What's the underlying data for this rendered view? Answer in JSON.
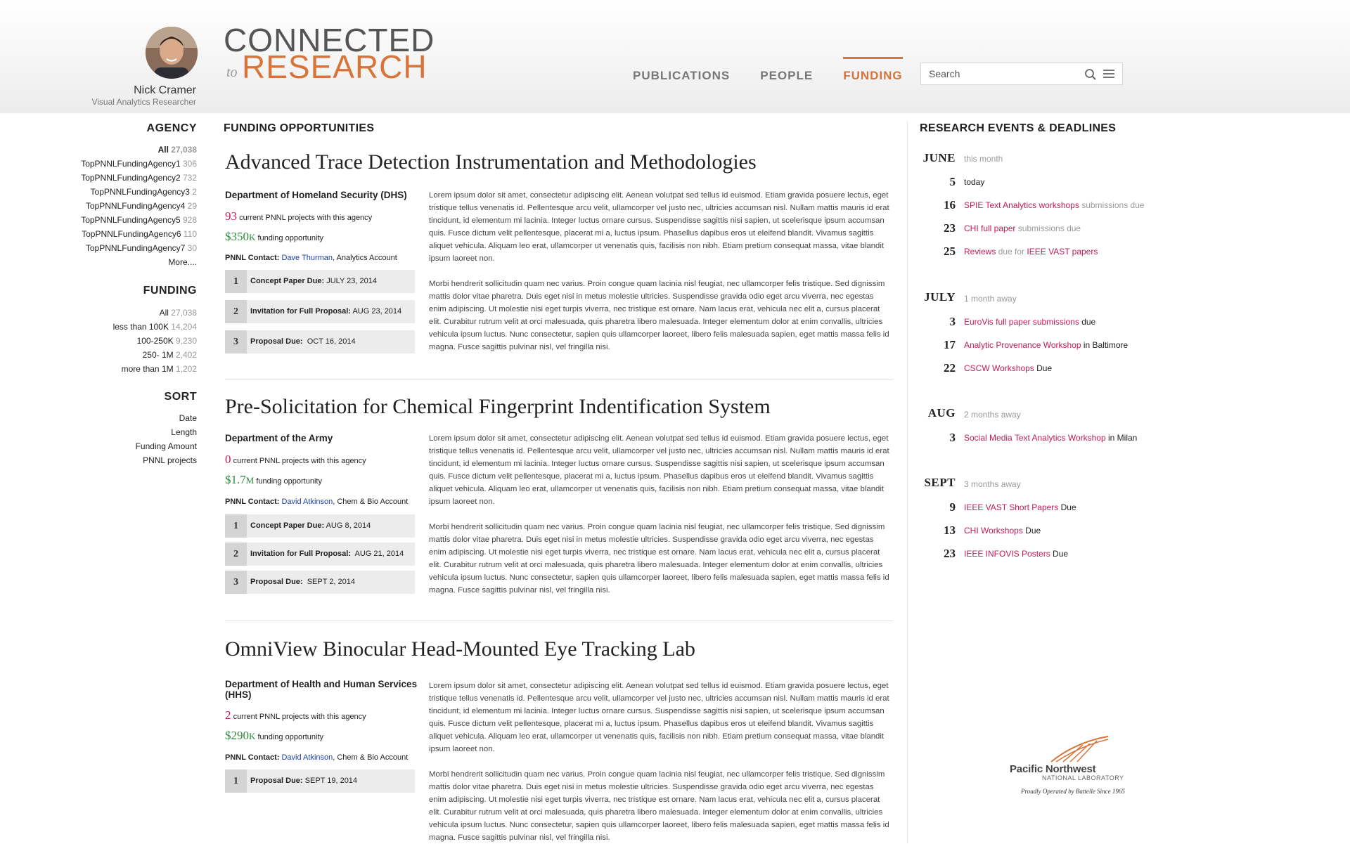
{
  "user": {
    "name": "Nick Cramer",
    "title": "Visual Analytics Researcher"
  },
  "logo": {
    "line1": "CONNECTED",
    "to": "to",
    "line2": "RESEARCH"
  },
  "nav": [
    {
      "label": "PUBLICATIONS",
      "active": false
    },
    {
      "label": "PEOPLE",
      "active": false
    },
    {
      "label": "FUNDING",
      "active": true
    }
  ],
  "search": {
    "placeholder": "Search"
  },
  "colors": {
    "accent": "#d8743a",
    "highlight": "#c21a55",
    "money": "#2e8b3e",
    "link": "#1c3fa8"
  },
  "sidebar": {
    "agency": {
      "heading": "AGENCY",
      "items": [
        {
          "label": "All",
          "count": "27,038"
        },
        {
          "label": "TopPNNLFundingAgency1",
          "count": "306"
        },
        {
          "label": "TopPNNLFundingAgency2",
          "count": "732"
        },
        {
          "label": "TopPNNLFundingAgency3",
          "count": "2"
        },
        {
          "label": "TopPNNLFundingAgency4",
          "count": "29"
        },
        {
          "label": "TopPNNLFundingAgency5",
          "count": "928"
        },
        {
          "label": "TopPNNLFundingAgency6",
          "count": "110"
        },
        {
          "label": "TopPNNLFundingAgency7",
          "count": "30"
        }
      ],
      "more": "More...."
    },
    "funding": {
      "heading": "FUNDING",
      "items": [
        {
          "label": "All",
          "count": "27,038"
        },
        {
          "label": "less than 100K",
          "count": "14,204"
        },
        {
          "label": "100-250K",
          "count": "9,230"
        },
        {
          "label": "250- 1M",
          "count": "2,402"
        },
        {
          "label": "more than 1M",
          "count": "1,202"
        }
      ]
    },
    "sort": {
      "heading": "SORT",
      "items": [
        "Date",
        "Length",
        "Funding Amount",
        "PNNL projects"
      ]
    }
  },
  "main": {
    "heading": "FUNDING OPPORTUNITIES",
    "projects_label": "current PNNL projects with this agency",
    "funding_label": "funding opportunity",
    "contact_label": "PNNL Contact:",
    "opportunities": [
      {
        "title": "Advanced Trace Detection Instrumentation and Methodologies",
        "agency": "Department of Homeland Security (DHS)",
        "projects": "93",
        "amount": "$350",
        "amount_unit": "K",
        "contact_name": "Dave Thurman",
        "contact_account": ", Analytics Account",
        "steps": [
          {
            "n": "1",
            "label": "Concept Paper Due:",
            "date": "JULY 23, 2014"
          },
          {
            "n": "2",
            "label": "Invitation for Full Proposal:",
            "date": "AUG 23, 2014"
          },
          {
            "n": "3",
            "label": "Proposal Due:",
            "date": "OCT 16, 2014"
          }
        ],
        "para1": "Lorem ipsum dolor sit amet, consectetur adipiscing elit. Aenean volutpat sed tellus id euismod. Etiam gravida posuere lectus, eget tristique tellus venenatis id. Pellentesque arcu velit, ullamcorper vel justo nec, ultricies accumsan nisl. Nullam mattis mauris id erat tincidunt, id elementum mi lacinia. Integer luctus ornare cursus. Suspendisse sagittis nisi sapien, ut scelerisque ipsum accumsan quis. Fusce dictum velit pellentesque, placerat mi a, luctus ipsum. Phasellus dapibus eros ut eleifend blandit. Vivamus sagittis aliquet vehicula. Aliquam leo erat, ullamcorper ut venenatis quis, facilisis non nibh. Etiam pretium consequat massa, vitae blandit ipsum laoreet non.",
        "para2": "Morbi hendrerit sollicitudin quam nec varius. Proin congue quam lacinia nisl feugiat, nec ullamcorper felis tristique. Sed dignissim mattis dolor vitae pharetra. Duis eget nisi in metus molestie ultricies. Suspendisse gravida odio eget arcu viverra, nec egestas enim adipiscing. Ut molestie nisi eget turpis viverra, nec tristique est ornare. Nam lacus erat, vehicula nec elit a, cursus placerat elit. Curabitur rutrum velit at orci malesuada, quis pharetra libero malesuada. Integer elementum dolor at enim convallis, ultricies vehicula ipsum luctus. Nunc consectetur, sapien quis ullamcorper laoreet, libero felis malesuada sapien, eget mattis massa felis id magna. Fusce sagittis pulvinar nisl, vel fringilla nisi."
      },
      {
        "title": "Pre-Solicitation for Chemical Fingerprint Indentification System",
        "agency": "Department of the Army",
        "projects": "0",
        "amount": "$1.7",
        "amount_unit": "M",
        "contact_name": "David Atkinson",
        "contact_account": ", Chem & Bio Account",
        "steps": [
          {
            "n": "1",
            "label": "Concept Paper Due:",
            "date": "AUG 8, 2014"
          },
          {
            "n": "2",
            "label": "Invitation for Full Proposal:",
            "date": "AUG 21, 2014"
          },
          {
            "n": "3",
            "label": "Proposal Due:",
            "date": "SEPT 2, 2014"
          }
        ],
        "para1": "Lorem ipsum dolor sit amet, consectetur adipiscing elit. Aenean volutpat sed tellus id euismod. Etiam gravida posuere lectus, eget tristique tellus venenatis id. Pellentesque arcu velit, ullamcorper vel justo nec, ultricies accumsan nisl. Nullam mattis mauris id erat tincidunt, id elementum mi lacinia. Integer luctus ornare cursus. Suspendisse sagittis nisi sapien, ut scelerisque ipsum accumsan quis. Fusce dictum velit pellentesque, placerat mi a, luctus ipsum. Phasellus dapibus eros ut eleifend blandit. Vivamus sagittis aliquet vehicula. Aliquam leo erat, ullamcorper ut venenatis quis, facilisis non nibh. Etiam pretium consequat massa, vitae blandit ipsum laoreet non.",
        "para2": "Morbi hendrerit sollicitudin quam nec varius. Proin congue quam lacinia nisl feugiat, nec ullamcorper felis tristique. Sed dignissim mattis dolor vitae pharetra. Duis eget nisi in metus molestie ultricies. Suspendisse gravida odio eget arcu viverra, nec egestas enim adipiscing. Ut molestie nisi eget turpis viverra, nec tristique est ornare. Nam lacus erat, vehicula nec elit a, cursus placerat elit. Curabitur rutrum velit at orci malesuada, quis pharetra libero malesuada. Integer elementum dolor at enim convallis, ultricies vehicula ipsum luctus. Nunc consectetur, sapien quis ullamcorper laoreet, libero felis malesuada sapien, eget mattis massa felis id magna. Fusce sagittis pulvinar nisl, vel fringilla nisi."
      },
      {
        "title": "OmniView Binocular Head-Mounted Eye Tracking Lab",
        "agency": "Department of Health and Human Services (HHS)",
        "projects": "2",
        "amount": "$290",
        "amount_unit": "K",
        "contact_name": "David Atkinson",
        "contact_account": ", Chem & Bio Account",
        "steps": [
          {
            "n": "1",
            "label": "Proposal Due:",
            "date": "SEPT 19, 2014"
          }
        ],
        "para1": "Lorem ipsum dolor sit amet, consectetur adipiscing elit. Aenean volutpat sed tellus id euismod. Etiam gravida posuere lectus, eget tristique tellus venenatis id. Pellentesque arcu velit, ullamcorper vel justo nec, ultricies accumsan nisl. Nullam mattis mauris id erat tincidunt, id elementum mi lacinia. Integer luctus ornare cursus. Suspendisse sagittis nisi sapien, ut scelerisque ipsum accumsan quis. Fusce dictum velit pellentesque, placerat mi a, luctus ipsum. Phasellus dapibus eros ut eleifend blandit. Vivamus sagittis aliquet vehicula. Aliquam leo erat, ullamcorper ut venenatis quis, facilisis non nibh. Etiam pretium consequat massa, vitae blandit ipsum laoreet non.",
        "para2": "Morbi hendrerit sollicitudin quam nec varius. Proin congue quam lacinia nisl feugiat, nec ullamcorper felis tristique. Sed dignissim mattis dolor vitae pharetra. Duis eget nisi in metus molestie ultricies. Suspendisse gravida odio eget arcu viverra, nec egestas enim adipiscing. Ut molestie nisi eget turpis viverra, nec tristique est ornare. Nam lacus erat, vehicula nec elit a, cursus placerat elit. Curabitur rutrum velit at orci malesuada, quis pharetra libero malesuada. Integer elementum dolor at enim convallis, ultricies vehicula ipsum luctus. Nunc consectetur, sapien quis ullamcorper laoreet, libero felis malesuada sapien, eget mattis massa felis id magna. Fusce sagittis pulvinar nisl, vel fringilla nisi."
      }
    ]
  },
  "events": {
    "heading": "RESEARCH EVENTS & DEADLINES",
    "months": [
      {
        "name": "JUNE",
        "relative": "this month",
        "items": [
          {
            "day": "5",
            "parts": [
              {
                "t": "today",
                "s": ""
              }
            ]
          },
          {
            "day": "16",
            "parts": [
              {
                "t": "SPIE Text Analytics workshops",
                "s": "hl"
              },
              {
                "t": " submissions due",
                "s": "mute"
              }
            ]
          },
          {
            "day": "23",
            "parts": [
              {
                "t": "CHI full paper",
                "s": "hl"
              },
              {
                "t": " submissions due",
                "s": "mute"
              }
            ]
          },
          {
            "day": "25",
            "parts": [
              {
                "t": "Reviews",
                "s": "hl"
              },
              {
                "t": " due for ",
                "s": "mute"
              },
              {
                "t": "IEEE VAST papers",
                "s": "hl"
              }
            ]
          }
        ]
      },
      {
        "name": "JULY",
        "relative": "1 month away",
        "items": [
          {
            "day": "3",
            "parts": [
              {
                "t": "EuroVis full paper submissions",
                "s": "hl"
              },
              {
                "t": " due",
                "s": ""
              }
            ]
          },
          {
            "day": "17",
            "parts": [
              {
                "t": "Analytic Provenance Workshop",
                "s": "hl"
              },
              {
                "t": " in Baltimore",
                "s": ""
              }
            ]
          },
          {
            "day": "22",
            "parts": [
              {
                "t": "CSCW Workshops",
                "s": "hl"
              },
              {
                "t": " Due",
                "s": ""
              }
            ]
          }
        ]
      },
      {
        "name": "AUG",
        "relative": "2 months away",
        "items": [
          {
            "day": "3",
            "parts": [
              {
                "t": "Social Media Text Analytics Workshop",
                "s": "hl"
              },
              {
                "t": " in Milan",
                "s": ""
              }
            ]
          }
        ]
      },
      {
        "name": "SEPT",
        "relative": "3 months away",
        "items": [
          {
            "day": "9",
            "parts": [
              {
                "t": "IEEE VAST Short Papers",
                "s": "hl"
              },
              {
                "t": " Due",
                "s": ""
              }
            ]
          },
          {
            "day": "13",
            "parts": [
              {
                "t": "CHI Workshops",
                "s": "hl"
              },
              {
                "t": " Due",
                "s": ""
              }
            ]
          },
          {
            "day": "23",
            "parts": [
              {
                "t": "IEEE INFOVIS Posters",
                "s": "hl"
              },
              {
                "t": " Due",
                "s": ""
              }
            ]
          }
        ]
      }
    ]
  },
  "footer_logo": {
    "name": "Pacific Northwest",
    "sub": "NATIONAL LABORATORY",
    "operated": "Proudly Operated by Battelle Since 1965"
  }
}
